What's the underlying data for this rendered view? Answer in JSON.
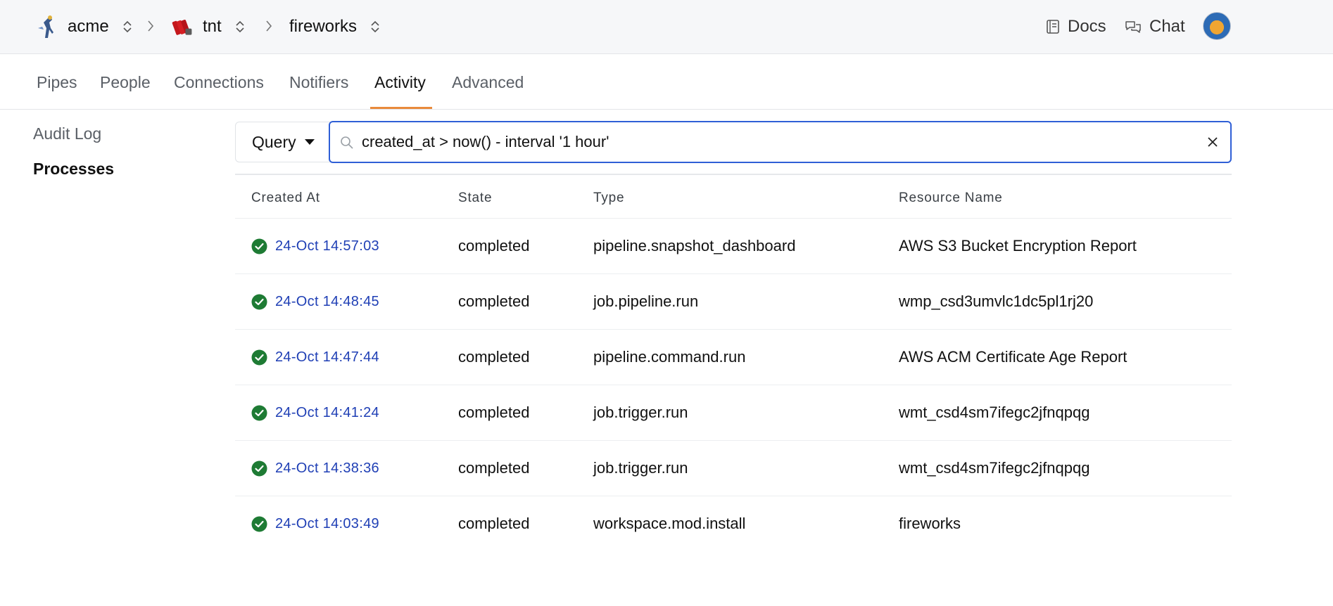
{
  "breadcrumb": {
    "org": "acme",
    "workspace": "tnt",
    "project": "fireworks"
  },
  "topnav": {
    "docs": "Docs",
    "chat": "Chat"
  },
  "tabs": [
    {
      "label": "Pipes"
    },
    {
      "label": "People"
    },
    {
      "label": "Connections"
    },
    {
      "label": "Notifiers"
    },
    {
      "label": "Activity",
      "active": true
    },
    {
      "label": "Advanced"
    }
  ],
  "sidebar": {
    "items": [
      {
        "label": "Audit Log"
      },
      {
        "label": "Processes",
        "active": true
      }
    ]
  },
  "search": {
    "mode": "Query",
    "value": "created_at > now() - interval '1 hour'"
  },
  "table": {
    "columns": [
      "Created At",
      "State",
      "Type",
      "Resource Name"
    ],
    "rows": [
      {
        "created_at": "24-Oct 14:57:03",
        "state": "completed",
        "type": "pipeline.snapshot_dashboard",
        "resource": "AWS S3 Bucket Encryption Report"
      },
      {
        "created_at": "24-Oct 14:48:45",
        "state": "completed",
        "type": "job.pipeline.run",
        "resource": "wmp_csd3umvlc1dc5pl1rj20"
      },
      {
        "created_at": "24-Oct 14:47:44",
        "state": "completed",
        "type": "pipeline.command.run",
        "resource": "AWS ACM Certificate Age Report"
      },
      {
        "created_at": "24-Oct 14:41:24",
        "state": "completed",
        "type": "job.trigger.run",
        "resource": "wmt_csd4sm7ifegc2jfnqpqg"
      },
      {
        "created_at": "24-Oct 14:38:36",
        "state": "completed",
        "type": "job.trigger.run",
        "resource": "wmt_csd4sm7ifegc2jfnqpqg"
      },
      {
        "created_at": "24-Oct 14:03:49",
        "state": "completed",
        "type": "workspace.mod.install",
        "resource": "fireworks"
      }
    ]
  },
  "colors": {
    "accent_tab": "#e98a3b",
    "link": "#1f3fb5",
    "status_success": "#1e7b34",
    "focus_border": "#2f5fd6"
  }
}
